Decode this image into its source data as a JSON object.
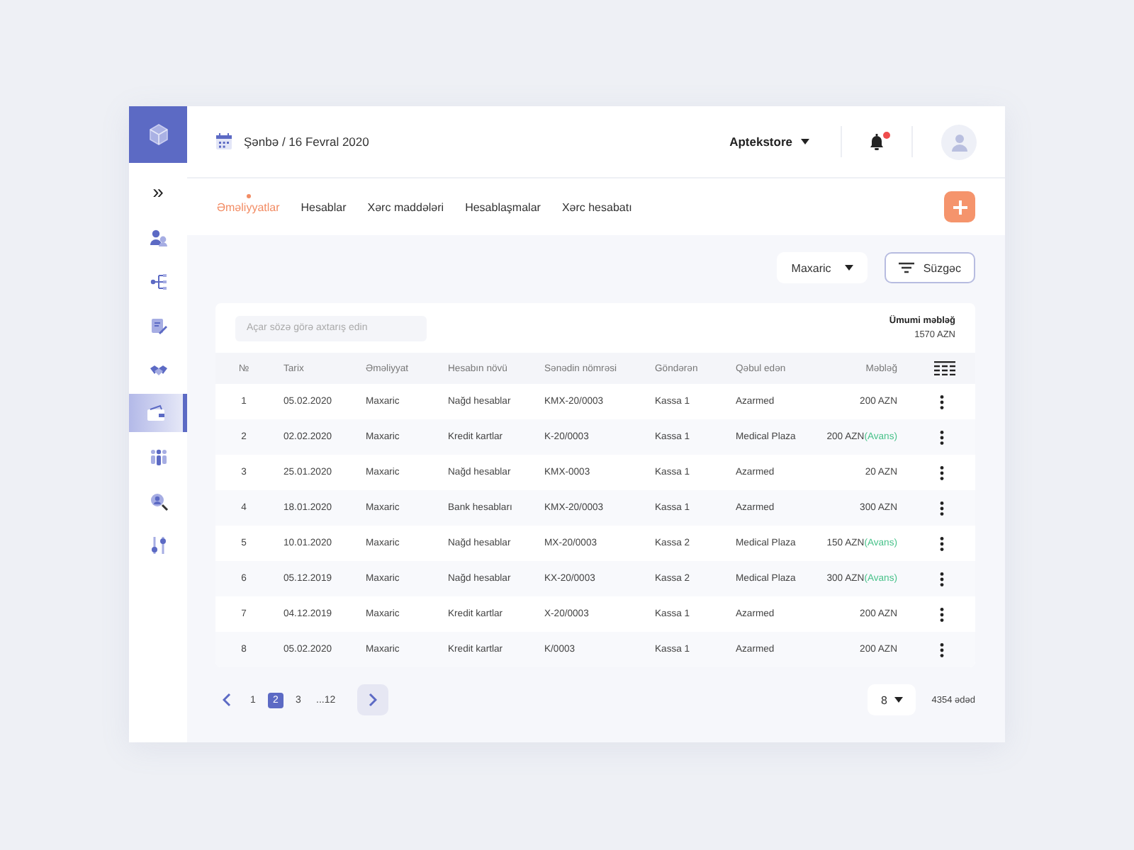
{
  "header": {
    "date": "Şənbə / 16 Fevral 2020",
    "store": "Aptekstore",
    "notification_unread": true
  },
  "sidebar": {
    "expand": "»",
    "items": [
      {
        "selected": false
      },
      {
        "selected": false
      },
      {
        "selected": false
      },
      {
        "selected": false
      },
      {
        "selected": true
      },
      {
        "selected": false
      },
      {
        "selected": false
      },
      {
        "selected": false
      }
    ]
  },
  "tabs": [
    {
      "label": "Əməliyyatlar",
      "selected": true
    },
    {
      "label": "Hesablar",
      "selected": false
    },
    {
      "label": "Xərc maddələri",
      "selected": false
    },
    {
      "label": "Hesablaşmalar",
      "selected": false
    },
    {
      "label": "Xərc hesabatı",
      "selected": false
    }
  ],
  "filters": {
    "type": "Maxaric",
    "filter_button": "Süzgəc"
  },
  "search": {
    "placeholder": "Açar sözə görə axtarış edin"
  },
  "total": {
    "label": "Ümumi məbləğ",
    "value": "1570 AZN"
  },
  "table": {
    "columns": [
      "№",
      "Tarix",
      "Əməliyyat",
      "Hesabın növü",
      "Sənədin nömrəsi",
      "Göndərən",
      "Qəbul  edən",
      "Məbləğ"
    ],
    "rows": [
      {
        "no": "1",
        "date": "05.02.2020",
        "operation": "Maxaric",
        "account_type": "Nağd hesablar",
        "document": "KMX-20/0003",
        "sender": "Kassa 1",
        "receiver": "Azarmed",
        "amount": "200 AZN"
      },
      {
        "no": "2",
        "date": "02.02.2020",
        "operation": "Maxaric",
        "account_type": "Kredit kartlar",
        "document": "K-20/0003",
        "sender": "Kassa 1",
        "receiver": "Medical Plaza",
        "amount": "200 AZN",
        "note": "(Avans)"
      },
      {
        "no": "3",
        "date": "25.01.2020",
        "operation": "Maxaric",
        "account_type": "Nağd hesablar",
        "document": "KMX-0003",
        "sender": "Kassa 1",
        "receiver": "Azarmed",
        "amount": "20 AZN"
      },
      {
        "no": "4",
        "date": "18.01.2020",
        "operation": "Maxaric",
        "account_type": "Bank hesabları",
        "document": "KMX-20/0003",
        "sender": "Kassa 1",
        "receiver": "Azarmed",
        "amount": "300 AZN"
      },
      {
        "no": "5",
        "date": "10.01.2020",
        "operation": "Maxaric",
        "account_type": "Nağd hesablar",
        "document": "MX-20/0003",
        "sender": "Kassa 2",
        "receiver": "Medical Plaza",
        "amount": "150 AZN",
        "note": "(Avans)"
      },
      {
        "no": "6",
        "date": "05.12.2019",
        "operation": "Maxaric",
        "account_type": "Nağd hesablar",
        "document": "KX-20/0003",
        "sender": "Kassa 2",
        "receiver": "Medical Plaza",
        "amount": "300 AZN",
        "note": "(Avans)"
      },
      {
        "no": "7",
        "date": "04.12.2019",
        "operation": "Maxaric",
        "account_type": "Kredit kartlar",
        "document": "X-20/0003",
        "sender": "Kassa 1",
        "receiver": "Azarmed",
        "amount": "200 AZN"
      },
      {
        "no": "8",
        "date": "05.02.2020",
        "operation": "Maxaric",
        "account_type": "Kredit kartlar",
        "document": "K/0003",
        "sender": "Kassa 1",
        "receiver": "Azarmed",
        "amount": "200 AZN"
      }
    ]
  },
  "pagination": {
    "pages": [
      {
        "label": "1",
        "selected": false
      },
      {
        "label": "2",
        "selected": true
      },
      {
        "label": "3",
        "selected": false
      },
      {
        "label": "...12",
        "selected": false
      }
    ],
    "per_page": "8",
    "count": "4354 ədəd"
  }
}
